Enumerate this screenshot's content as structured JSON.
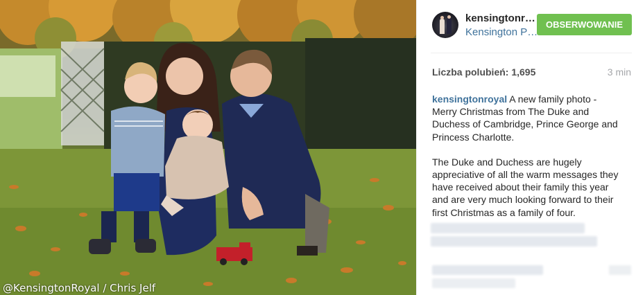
{
  "photo": {
    "credit": "@KensingtonRoyal / Chris Jelf"
  },
  "post": {
    "username": "kensingtonroyal",
    "location": "Kensington Palace",
    "follow_label": "OBSERWOWANIE",
    "likes_label": "Liczba polubień: 1,695",
    "time_ago": "3 min",
    "caption_user": "kensingtonroyal",
    "caption_text_1": " A new family photo - Merry Christmas from The Duke and Duchess of Cambridge, Prince George and Princess Charlotte.",
    "caption_text_2": "The Duke and Duchess are hugely appreciative of all the warm messages they have received about their family this year and are very much looking forward to their first Christmas as a family of four."
  },
  "colors": {
    "accent_green": "#70c050",
    "link_blue": "#3f729b"
  }
}
